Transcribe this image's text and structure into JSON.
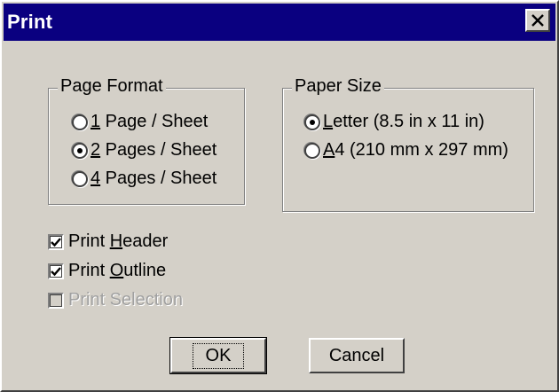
{
  "window": {
    "title": "Print",
    "close_icon": "close-x-icon"
  },
  "page_format": {
    "label": "Page Format",
    "options": [
      {
        "accel": "1",
        "rest": " Page / Sheet",
        "selected": false
      },
      {
        "accel": "2",
        "rest": " Pages / Sheet",
        "selected": true
      },
      {
        "accel": "4",
        "rest": " Pages / Sheet",
        "selected": false
      }
    ]
  },
  "paper_size": {
    "label": "Paper Size",
    "options": [
      {
        "accel": "L",
        "rest": "etter (8.5 in x 11 in)",
        "selected": true
      },
      {
        "accel": "A",
        "rest": "4 (210 mm x 297 mm)",
        "selected": false
      }
    ]
  },
  "checks": {
    "header": {
      "pre": "Print ",
      "accel": "H",
      "post": "eader",
      "checked": true
    },
    "outline": {
      "pre": "Print ",
      "accel": "O",
      "post": "utline",
      "checked": true
    },
    "selection": {
      "text": "Print Selection",
      "checked": false,
      "disabled": true
    }
  },
  "buttons": {
    "ok": "OK",
    "cancel": "Cancel"
  }
}
